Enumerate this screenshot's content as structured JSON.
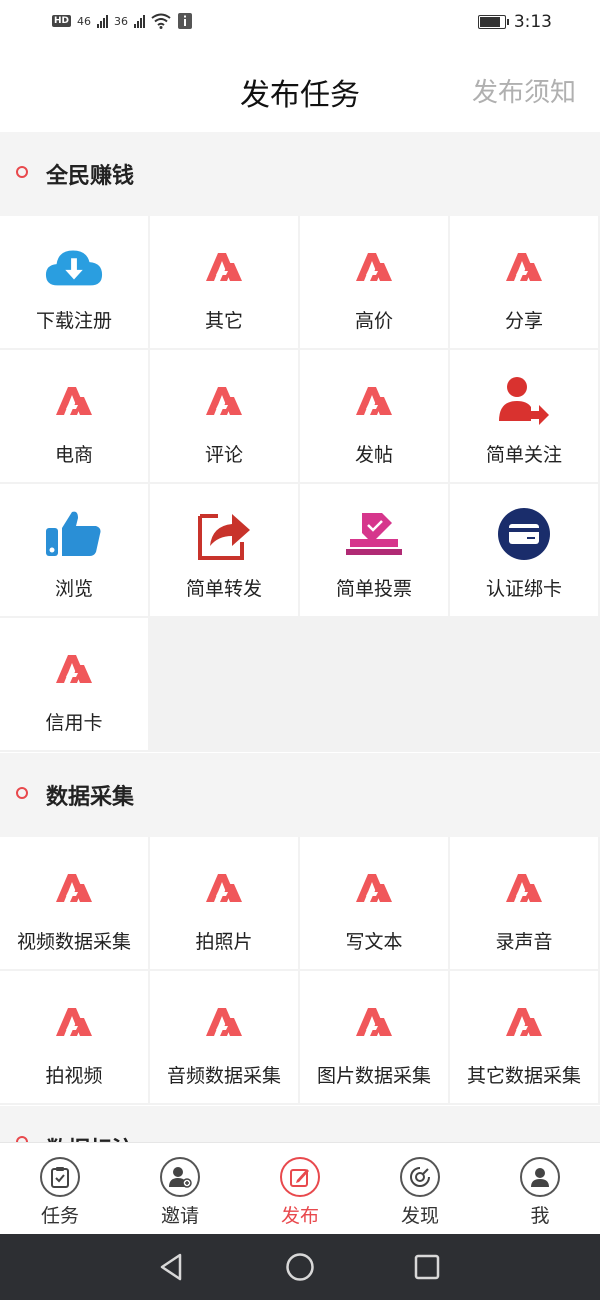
{
  "status_bar": {
    "time": "3:13",
    "hd": "HD",
    "net1": "46",
    "net2": "36"
  },
  "header": {
    "title": "发布任务",
    "notice": "发布须知"
  },
  "sections": [
    {
      "title": "全民赚钱",
      "items": [
        {
          "label": "下载注册",
          "icon": "cloud-download-icon"
        },
        {
          "label": "其它",
          "icon": "brand-logo-icon"
        },
        {
          "label": "高价",
          "icon": "brand-logo-icon"
        },
        {
          "label": "分享",
          "icon": "brand-logo-icon"
        },
        {
          "label": "电商",
          "icon": "brand-logo-icon"
        },
        {
          "label": "评论",
          "icon": "brand-logo-icon"
        },
        {
          "label": "发帖",
          "icon": "brand-logo-icon"
        },
        {
          "label": "简单关注",
          "icon": "user-follow-icon"
        },
        {
          "label": "浏览",
          "icon": "thumbs-up-icon"
        },
        {
          "label": "简单转发",
          "icon": "share-forward-icon"
        },
        {
          "label": "简单投票",
          "icon": "ballot-box-icon"
        },
        {
          "label": "认证绑卡",
          "icon": "bank-card-icon"
        },
        {
          "label": "信用卡",
          "icon": "brand-logo-icon"
        }
      ]
    },
    {
      "title": "数据采集",
      "items": [
        {
          "label": "视频数据采集",
          "icon": "brand-logo-icon"
        },
        {
          "label": "拍照片",
          "icon": "brand-logo-icon"
        },
        {
          "label": "写文本",
          "icon": "brand-logo-icon"
        },
        {
          "label": "录声音",
          "icon": "brand-logo-icon"
        },
        {
          "label": "拍视频",
          "icon": "brand-logo-icon"
        },
        {
          "label": "音频数据采集",
          "icon": "brand-logo-icon"
        },
        {
          "label": "图片数据采集",
          "icon": "brand-logo-icon"
        },
        {
          "label": "其它数据采集",
          "icon": "brand-logo-icon"
        }
      ]
    }
  ],
  "next_section_title": "数据标注",
  "tabs": [
    {
      "label": "任务",
      "icon": "clipboard-icon",
      "active": false
    },
    {
      "label": "邀请",
      "icon": "invite-user-icon",
      "active": false
    },
    {
      "label": "发布",
      "icon": "edit-icon",
      "active": true
    },
    {
      "label": "发现",
      "icon": "compass-icon",
      "active": false
    },
    {
      "label": "我",
      "icon": "profile-icon",
      "active": false
    }
  ],
  "colors": {
    "accent": "#e8494d",
    "brand_logo": "#f0575a",
    "cloud": "#2a9ee0",
    "card": "#1a2d6b",
    "vote": "#d6368c"
  }
}
